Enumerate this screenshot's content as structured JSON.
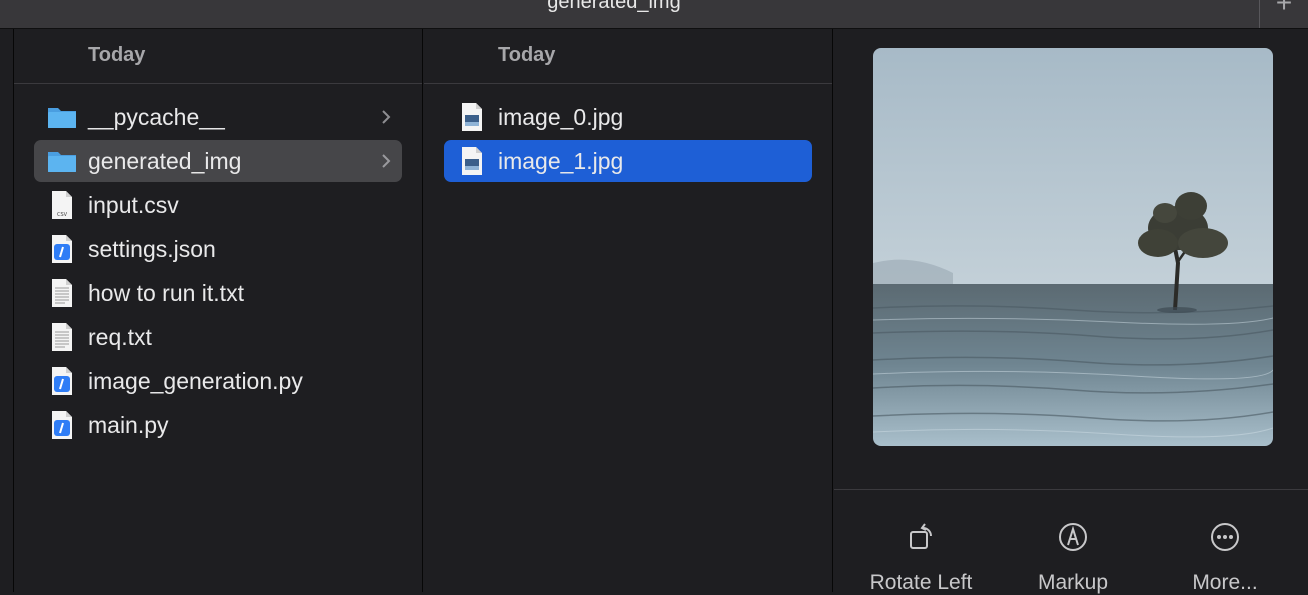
{
  "window": {
    "title": "generated_img",
    "add_tab": "+"
  },
  "column1": {
    "header": "Today",
    "items": [
      {
        "label": "__pycache__",
        "kind": "folder",
        "selected": "none"
      },
      {
        "label": "generated_img",
        "kind": "folder",
        "selected": "inactive"
      },
      {
        "label": "input.csv",
        "kind": "csv"
      },
      {
        "label": "settings.json",
        "kind": "code"
      },
      {
        "label": "how to run it.txt",
        "kind": "text"
      },
      {
        "label": "req.txt",
        "kind": "text"
      },
      {
        "label": "image_generation.py",
        "kind": "code"
      },
      {
        "label": "main.py",
        "kind": "code"
      }
    ]
  },
  "column2": {
    "header": "Today",
    "items": [
      {
        "label": "image_0.jpg",
        "kind": "image"
      },
      {
        "label": "image_1.jpg",
        "kind": "image",
        "selected": "active"
      }
    ]
  },
  "preview": {
    "actions": [
      {
        "label": "Rotate Left",
        "icon": "rotate-left-icon"
      },
      {
        "label": "Markup",
        "icon": "markup-icon"
      },
      {
        "label": "More...",
        "icon": "more-icon"
      }
    ]
  },
  "colors": {
    "selection_active": "#1e5fd6",
    "selection_inactive": "#464649",
    "folder": "#5cb4f0"
  }
}
